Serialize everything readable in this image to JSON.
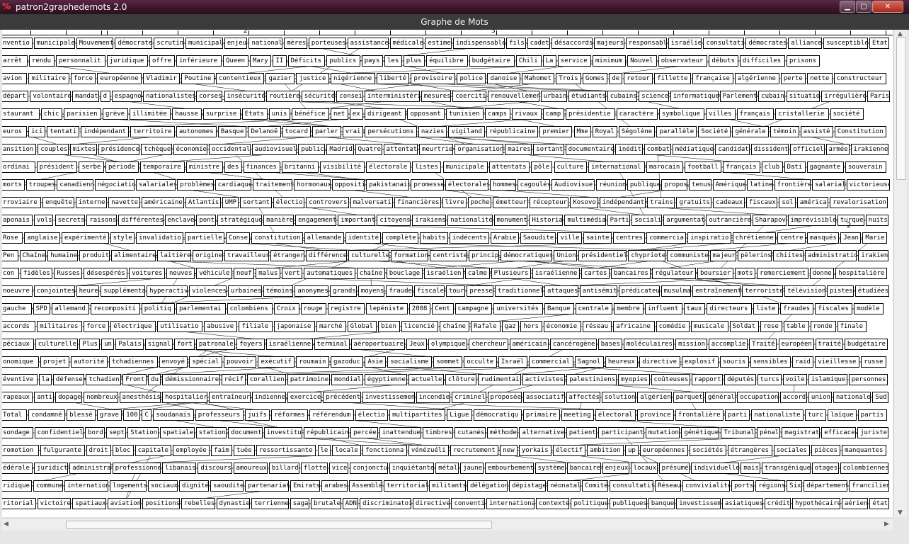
{
  "window": {
    "title": "patron2graphedemots 2.0",
    "icon": "app-logo-icon",
    "controls": {
      "minimize": "minimize-icon",
      "maximize": "maximize-icon",
      "close": "close-icon"
    }
  },
  "panel": {
    "title": "Graphe de Mots"
  },
  "ruler": {
    "labels": [
      "2",
      "3"
    ]
  },
  "side_marker": "2",
  "colors": {
    "titlebar": "#3a1729",
    "panel_header": "#3b3b3b",
    "node_border": "#000000",
    "canvas": "#ffffff"
  },
  "nodes": [
    [
      "nventio",
      "municipale",
      "Mouvement",
      "démocrate",
      "scrutin",
      "municipal",
      "enjeu",
      "national",
      "mères",
      "porteuses",
      "assistance",
      "médicale",
      "estime",
      "indispensable",
      "fils",
      "cadet",
      "désaccords",
      "majeurs",
      "responsabl",
      "israélie",
      "consultati",
      "démocrates",
      "alliance",
      "susceptible",
      "Etat"
    ],
    [
      "arrêt",
      "rendu",
      "personnalit",
      "juridique",
      "offre",
      "inférieure",
      "Queen",
      "Mary",
      "II",
      "Déficits",
      "publics",
      "pays",
      "les",
      "plus",
      "équilibre",
      "budgétaire",
      "Chili",
      "La",
      "service",
      "minimum",
      "Nouvel",
      "observateur",
      "débuts",
      "difficiles",
      "prisons"
    ],
    [
      "avion",
      "militaire",
      "force",
      "européenne",
      "Vladimir",
      "Poutine",
      "contentieux",
      "gazier",
      "justice",
      "nigérienne",
      "liberté",
      "provisoire",
      "police",
      "danoise",
      "Mahomet",
      "Trois",
      "Gomes",
      "de",
      "retour",
      "fillette",
      "française",
      "algérienne",
      "perte",
      "nette",
      "constructeur"
    ],
    [
      "départ",
      "volontaire",
      "mandat",
      "d",
      "espagno",
      "nationalistes",
      "corses",
      "insécurité",
      "routière",
      "sécurité",
      "consei",
      "interministéri",
      "mesures",
      "coerciti",
      "renouvellemen",
      "urbain",
      "étudiants",
      "cubains",
      "science",
      "informatique",
      "Parlement",
      "cubain",
      "situatio",
      "irrégulière",
      "Paris"
    ],
    [
      "staurant",
      "chic",
      "parisien",
      "grève",
      "illimitée",
      "hausse",
      "surprise",
      "Etats",
      "unis",
      "bénéfice",
      "net",
      "ex",
      "dirigeant",
      "opposant",
      "tunisien",
      "camps",
      "rivaux",
      "camp",
      "présidentie",
      "caractère",
      "symbolique",
      "villes",
      "français",
      "cristallerie",
      "société"
    ],
    [
      "euros",
      "ici",
      "tentati",
      "indépendant",
      "territoire",
      "autonomes",
      "Basque",
      "Delanoë",
      "tocard",
      "parler",
      "vrai",
      "persécutions",
      "nazies",
      "vigiland",
      "républicaine",
      "premier",
      "Mme",
      "Royal",
      "Ségolène",
      "parallèle",
      "Société",
      "générale",
      "témoin",
      "assisté",
      "Constitution"
    ],
    [
      "ansition",
      "couples",
      "mixtes",
      "présidence",
      "tchèque",
      "économie",
      "occidental",
      "audiovisuel",
      "public",
      "Madrid",
      "Quatre",
      "attentat",
      "meurtrie",
      "organisation",
      "maires",
      "sortant",
      "documentaire",
      "inédit",
      "combat",
      "médiatique",
      "candidat",
      "dissident",
      "officiel",
      "armée",
      "irakienne"
    ],
    [
      "ordinai",
      "président",
      "serbe",
      "période",
      "temporaire",
      "ministre",
      "des",
      "finances",
      "britanni",
      "visibilité",
      "électorale",
      "listes",
      "municipale",
      "attentats",
      "pôle",
      "culture",
      "international",
      "marocain",
      "football",
      "français",
      "club",
      "Dati",
      "gagnante",
      "souverain"
    ],
    [
      "morts",
      "troupes",
      "canadienn",
      "négociatio",
      "salariales",
      "problèmes",
      "cardiaque",
      "traitement",
      "hormonaux",
      "oppositi",
      "pakistanais",
      "promesse",
      "électorales",
      "hommes",
      "cagoulés",
      "Audiovisuel",
      "réunion",
      "publique",
      "propos",
      "tenus",
      "Amérique",
      "latine",
      "frontière",
      "salarial",
      "victorieuse"
    ],
    [
      "rroviaire",
      "enquête",
      "interne",
      "navette",
      "américaine",
      "Atlantis",
      "UMP",
      "sortant",
      "électio",
      "controvers",
      "malversati",
      "financières",
      "livre",
      "poche",
      "émetteur",
      "récepteur",
      "Kosovo",
      "indépendant",
      "trains",
      "gratuits",
      "cadeaux",
      "fiscaux",
      "sol",
      "américa",
      "revalorisation"
    ],
    [
      "aponais",
      "vols",
      "secrets",
      "raisons",
      "différentes",
      "enclave",
      "pont",
      "stratégique",
      "manière",
      "engagement",
      "important",
      "citoyens",
      "irakiens",
      "nationalité",
      "monument",
      "Historia",
      "multimédia",
      "Parti",
      "sociali",
      "argumentat",
      "outrancière",
      "Sharapov",
      "imprévisible",
      "turque",
      "nuits"
    ],
    [
      "Rose",
      "anglaise",
      "expérimenté",
      "style",
      "invalidatio",
      "partielle",
      "Conse",
      "constitution",
      "allemande",
      "identité",
      "complète",
      "habits",
      "indécents",
      "Arabie",
      "Saoudite",
      "ville",
      "sainte",
      "centres",
      "commercia",
      "inspiratio",
      "chrétienne",
      "centre",
      "masqués",
      "Jean",
      "Marie"
    ],
    [
      "Pen",
      "Chaîne",
      "humaine",
      "produit",
      "alimentaire",
      "laitière",
      "origine",
      "travailleur",
      "étranger",
      "différence",
      "culturelle",
      "formation",
      "centriste",
      "princip",
      "démocratiques",
      "Union",
      "présidentiel",
      "chypriote",
      "communiste",
      "majeur",
      "pèlerins",
      "chiites",
      "administratio",
      "irakien"
    ],
    [
      "con",
      "fidèles",
      "Russes",
      "désespérés",
      "voitures",
      "neuves",
      "véhicule",
      "neuf",
      "malus",
      "vert",
      "automatiques",
      "chaîne",
      "bouclage",
      "israélien",
      "calme",
      "Plusieurs",
      "israélienne",
      "cartes",
      "bancaires",
      "régulateur",
      "boursier",
      "mots",
      "remerciement",
      "donne",
      "hospitalière"
    ],
    [
      "noeuvre",
      "conjointes",
      "heure",
      "supplémenta",
      "hyperactiv",
      "violences",
      "urbaines",
      "témoins",
      "anonymes",
      "grands",
      "moyens",
      "fraude",
      "fiscale",
      "tour",
      "presse",
      "traditionnel",
      "attaques",
      "antisémit",
      "prédicateu",
      "musulma",
      "entraînement",
      "terroriste",
      "télévision",
      "pistes",
      "étudiées"
    ],
    [
      "gauche",
      "SPD",
      "allemand",
      "recompositi",
      "politiq",
      "parlementai",
      "colombiens",
      "Croix",
      "rouge",
      "registre",
      "lepéniste",
      "2008",
      "Cent",
      "campagne",
      "universités",
      "Banque",
      "centrale",
      "membre",
      "influent",
      "taux",
      "directeurs",
      "liste",
      "fraudes",
      "fiscales",
      "modèle"
    ],
    [
      "accords",
      "militaires",
      "force",
      "électrique",
      "utilisatio",
      "abusive",
      "filiale",
      "japonaise",
      "marché",
      "Global",
      "bien",
      "licencié",
      "chaîne",
      "Rafale",
      "gaz",
      "hors",
      "économie",
      "réseau",
      "africaine",
      "comédie",
      "musicale",
      "Soldat",
      "rose",
      "table",
      "ronde",
      "finale"
    ],
    [
      "péciaux",
      "culturelle",
      "Plus",
      "un",
      "Palais",
      "signal",
      "fort",
      "patronale",
      "foyers",
      "israélienne",
      "terminal",
      "aéroportuaire",
      "Jeux",
      "olympique",
      "chercheur",
      "américain",
      "cancérogène",
      "bases",
      "moléculaires",
      "mission",
      "accomplie",
      "Traité",
      "européen",
      "traité",
      "budgétaire"
    ],
    [
      "onomique",
      "projet",
      "autorité",
      "tchadiennes",
      "envoyé",
      "spécial",
      "pouvoir",
      "exécutif",
      "roumain",
      "gazoduc",
      "Asie",
      "socialisme",
      "sommet",
      "occulte",
      "Israël",
      "commercial",
      "Sagnol",
      "heureux",
      "directive",
      "explosif",
      "souris",
      "sensibles",
      "raid",
      "vieillesse",
      "russe"
    ],
    [
      "éventive",
      "la",
      "défense",
      "tchadien",
      "Front",
      "du",
      "démissionnaire",
      "récif",
      "corallien",
      "patrimoine",
      "mondial",
      "égyptienne",
      "actuelle",
      "clôture",
      "rudimentai",
      "activistes",
      "palestiniens",
      "myopies",
      "coûteuses",
      "rapport",
      "députés",
      "turcs",
      "voile",
      "islamique",
      "personnes"
    ],
    [
      "rapeaux",
      "anti",
      "dopage",
      "nombreux",
      "anesthésis",
      "hospitalier",
      "entraîneur",
      "indienne",
      "exercice",
      "précédent",
      "investissemen",
      "incendie",
      "criminel",
      "proposée",
      "associatif",
      "affectés",
      "solution",
      "algérien",
      "parquet",
      "général",
      "occupation",
      "accord",
      "union",
      "nationale",
      "Sud"
    ],
    [
      "Total",
      "condamné",
      "blessé",
      "grave",
      "100",
      "C",
      "soudanais",
      "professeurs",
      "juifs",
      "réformes",
      "référendum",
      "électio",
      "multipartites",
      "Ligue",
      "démocratiqu",
      "primaire",
      "meeting",
      "électoral",
      "province",
      "frontalière",
      "parti",
      "nationaliste",
      "turc",
      "laïque",
      "partis"
    ],
    [
      "sondage",
      "confidentiel",
      "bord",
      "sept",
      "Station",
      "spatiale",
      "station",
      "document",
      "investitu",
      "républicain",
      "percée",
      "inattendue",
      "timbres",
      "cutanés",
      "méthode",
      "alternative",
      "patient",
      "participant",
      "mutation",
      "génétique",
      "Tribunal",
      "pénal",
      "magistrat",
      "efficace",
      "juriste"
    ],
    [
      "romotion",
      "fulgurante",
      "droit",
      "bloc",
      "capitale",
      "employée",
      "faim",
      "tuée",
      "ressortissante",
      "le",
      "locale",
      "fonctionna",
      "vénézuéli",
      "recrutement",
      "new",
      "yorkais",
      "électif",
      "ambition",
      "up",
      "européennes",
      "sociétés",
      "étrangères",
      "sociales",
      "pièces",
      "manquantes"
    ],
    [
      "édérale",
      "juridict",
      "administra",
      "professionne",
      "libanais",
      "discours",
      "amoureux",
      "billard",
      "flotte",
      "vice",
      "conjonctu",
      "inquiétante",
      "métal",
      "jaune",
      "embourbement",
      "système",
      "bancaire",
      "enjeux",
      "locaux",
      "présumé",
      "individuelle",
      "mais",
      "transgénique",
      "otages",
      "colombiennes"
    ],
    [
      "ridique",
      "commune",
      "internation",
      "logements",
      "sociaux",
      "dignité",
      "saoudite",
      "partenariat",
      "Emirats",
      "arabes",
      "Assemblé",
      "territorial",
      "militants",
      "délégation",
      "dépistage",
      "néonatal",
      "Comité",
      "consultatif",
      "Réseau",
      "convivialité",
      "ports",
      "régions",
      "Six",
      "département",
      "francilien"
    ],
    [
      "ritorial",
      "victoire",
      "spatiaux",
      "aviation",
      "positions",
      "rebelles",
      "dynastie",
      "terrienne",
      "saga",
      "brutale",
      "ADN",
      "discriminatoi",
      "directive",
      "conventi",
      "internationa",
      "contexte",
      "politique",
      "publiques",
      "banque",
      "investissem",
      "asiatiques",
      "crédit",
      "hypothécaire",
      "aérien",
      "état"
    ]
  ]
}
